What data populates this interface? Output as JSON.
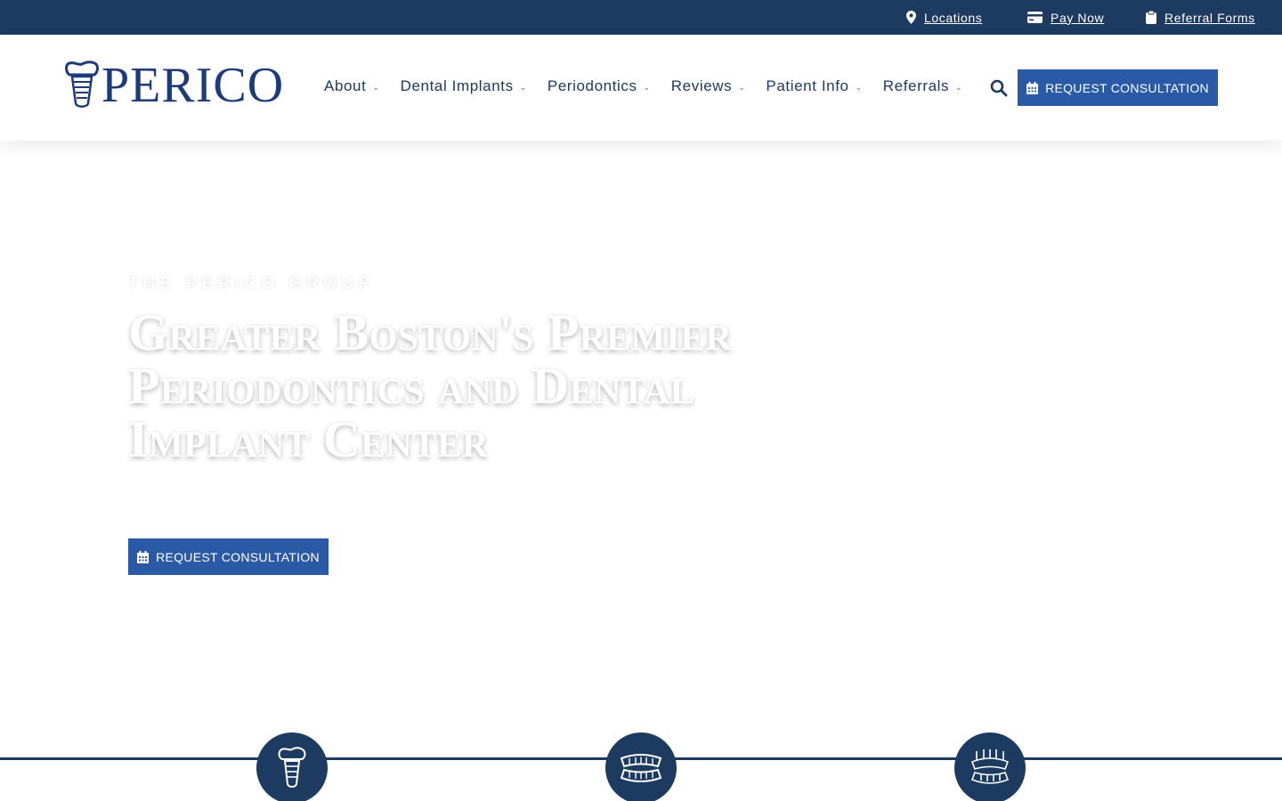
{
  "topbar": {
    "links": [
      {
        "label": "Locations",
        "icon": "map-pin-icon"
      },
      {
        "label": "Pay Now",
        "icon": "credit-card-icon"
      },
      {
        "label": "Referral Forms",
        "icon": "clipboard-icon"
      }
    ]
  },
  "header": {
    "logo_text": "PERICO",
    "nav": [
      {
        "label": "About"
      },
      {
        "label": "Dental Implants"
      },
      {
        "label": "Periodontics"
      },
      {
        "label": "Reviews"
      },
      {
        "label": "Patient Info"
      },
      {
        "label": "Referrals"
      }
    ],
    "cta_label": "REQUEST CONSULTATION"
  },
  "hero": {
    "eyebrow": "THE PERICO GROUP",
    "headline": "Greater Boston's Premier Periodontics and Dental Implant Center",
    "cta_label": "REQUEST CONSULTATION"
  },
  "features": {
    "icons": [
      "dental-implant-icon",
      "dentures-icon",
      "full-arch-implant-icon"
    ]
  },
  "colors": {
    "navy": "#1d3a60",
    "brand_blue": "#2a5aa6",
    "logo_blue": "#1d3a7a"
  }
}
